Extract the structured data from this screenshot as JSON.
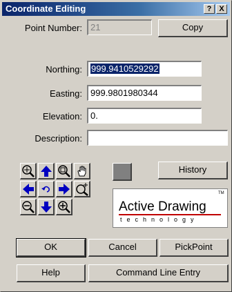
{
  "window": {
    "title": "Coordinate Editing",
    "help_glyph": "?",
    "close_glyph": "X"
  },
  "fields": {
    "point_number": {
      "label": "Point Number:",
      "value": "21"
    },
    "northing": {
      "label": "Northing:",
      "value": "999.9410529292"
    },
    "easting": {
      "label": "Easting:",
      "value": "999.9801980344"
    },
    "elevation": {
      "label": "Elevation:",
      "value": "0."
    },
    "description": {
      "label": "Description:",
      "value": ""
    }
  },
  "buttons": {
    "copy": "Copy",
    "history": "History",
    "ok": "OK",
    "cancel": "Cancel",
    "pickpoint": "PickPoint",
    "help": "Help",
    "command_line_entry": "Command Line Entry"
  },
  "nav_icons": [
    "zoom-window-icon",
    "arrow-up-icon",
    "zoom-extents-icon",
    "pan-hand-icon",
    "arrow-left-icon",
    "undo-view-icon",
    "arrow-right-icon",
    "zoom-realtime-icon",
    "zoom-out-icon",
    "arrow-down-icon",
    "zoom-in-icon"
  ],
  "logo": {
    "main": "Active Drawing",
    "sub": "technology",
    "tm": "TM"
  },
  "colors": {
    "title_start": "#0a246a",
    "title_end": "#a6caf0",
    "arrow_blue": "#0000c0",
    "face": "#d4d0c8"
  }
}
